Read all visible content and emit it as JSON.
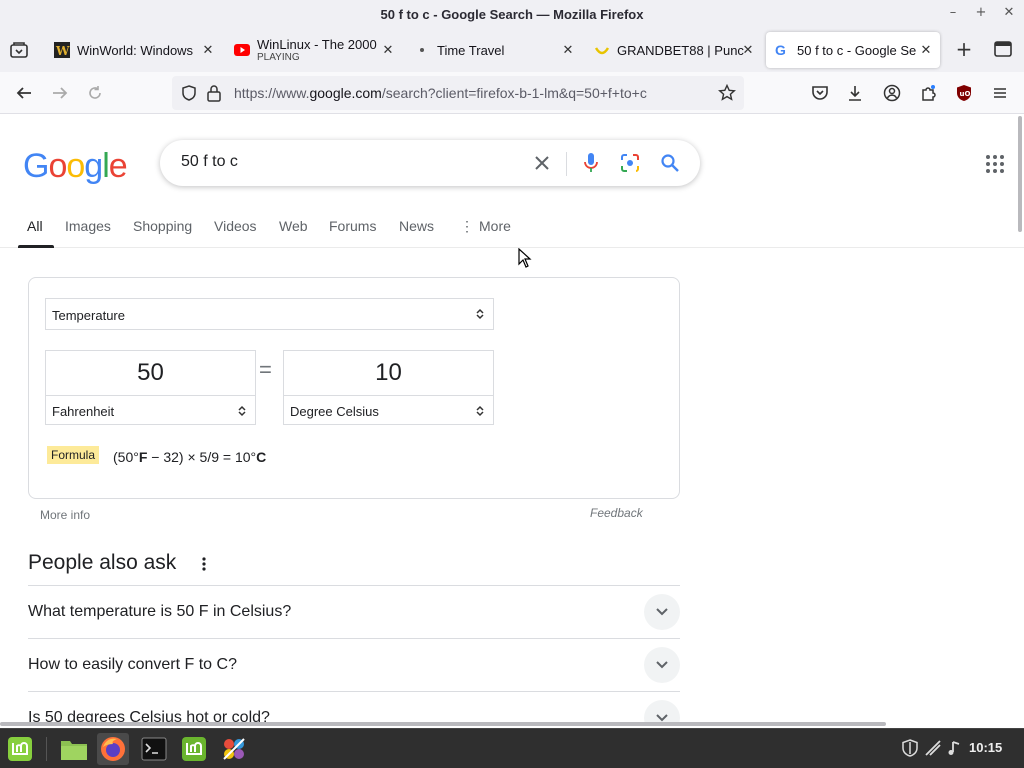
{
  "window": {
    "title": "50 f to c - Google Search — Mozilla Firefox",
    "controls": [
      "–",
      "+",
      "✕"
    ]
  },
  "tabs": [
    {
      "label": "WinWorld: Windows",
      "favicon": "winworld-icon",
      "subtitle": ""
    },
    {
      "label": "WinLinux - The 2000",
      "favicon": "youtube-icon",
      "subtitle": "PLAYING"
    },
    {
      "label": "Time Travel",
      "favicon": "dot-icon",
      "subtitle": ""
    },
    {
      "label": "GRANDBET88 | Punc",
      "favicon": "grandbet-icon",
      "subtitle": ""
    },
    {
      "label": "50 f to c - Google Se",
      "favicon": "google-icon",
      "subtitle": ""
    }
  ],
  "navbar": {
    "url_prefix": "https://www.",
    "url_host": "google.com",
    "url_rest": "/search?client=firefox-b-1-lm&q=50+f+to+c"
  },
  "google": {
    "logo_letters": [
      {
        "ch": "G",
        "color": "#4285F4"
      },
      {
        "ch": "o",
        "color": "#EA4335"
      },
      {
        "ch": "o",
        "color": "#FBBC05"
      },
      {
        "ch": "g",
        "color": "#4285F4"
      },
      {
        "ch": "l",
        "color": "#34A853"
      },
      {
        "ch": "e",
        "color": "#EA4335"
      }
    ],
    "query": "50 f to c",
    "tabs": [
      "All",
      "Images",
      "Shopping",
      "Videos",
      "Web",
      "Forums",
      "News",
      "More"
    ]
  },
  "converter": {
    "unit_type": "Temperature",
    "from_value": "50",
    "from_unit": "Fahrenheit",
    "to_value": "10",
    "to_unit": "Degree Celsius",
    "equals": "=",
    "formula_label": "Formula",
    "formula_pre": "(50°",
    "formula_unit1": "F",
    "formula_mid": " − 32) × 5/9 = 10°",
    "formula_unit2": "C",
    "more_info": "More info",
    "feedback": "Feedback"
  },
  "people_also_ask": {
    "title": "People also ask",
    "questions": [
      "What temperature is 50 F in Celsius?",
      "How to easily convert F to C?",
      "Is 50 degrees Celsius hot or cold?"
    ]
  },
  "taskbar": {
    "clock": "10:15"
  }
}
